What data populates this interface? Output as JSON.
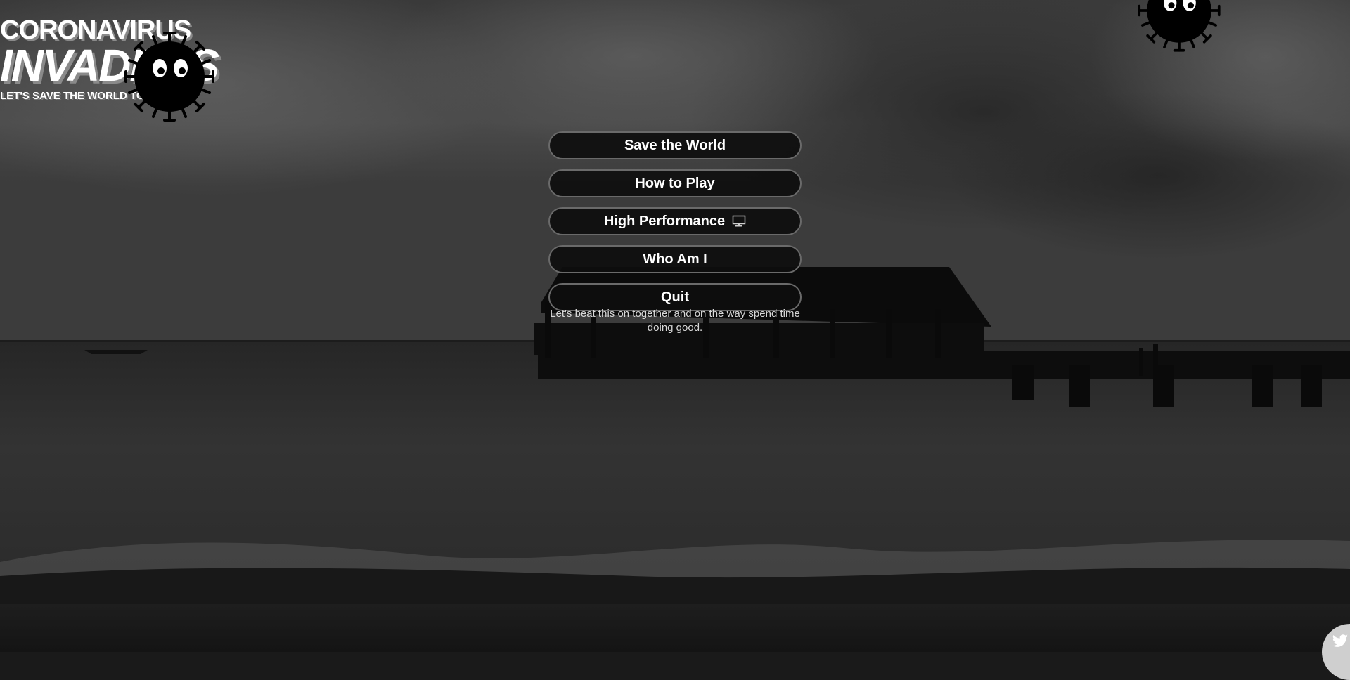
{
  "title": {
    "top": "CORONAVIRUS",
    "main": "INVADERS",
    "tagline": "LET'S SAVE THE WORLD TOGETHER!"
  },
  "menu": {
    "items": [
      {
        "label": "Save the World"
      },
      {
        "label": "How to Play"
      },
      {
        "label": "High Performance",
        "icon": "monitor-icon"
      },
      {
        "label": "Who Am I"
      },
      {
        "label": "Quit"
      }
    ]
  },
  "description": "Let's beat this on together and on the way spend time doing good.",
  "colors": {
    "button_bg": "#0e0e0e",
    "button_border": "#6a6a6a",
    "text": "#ffffff",
    "title_shadow": "#8a8a8a"
  },
  "icons": {
    "virus": "virus-icon",
    "twitter": "twitter-icon"
  }
}
